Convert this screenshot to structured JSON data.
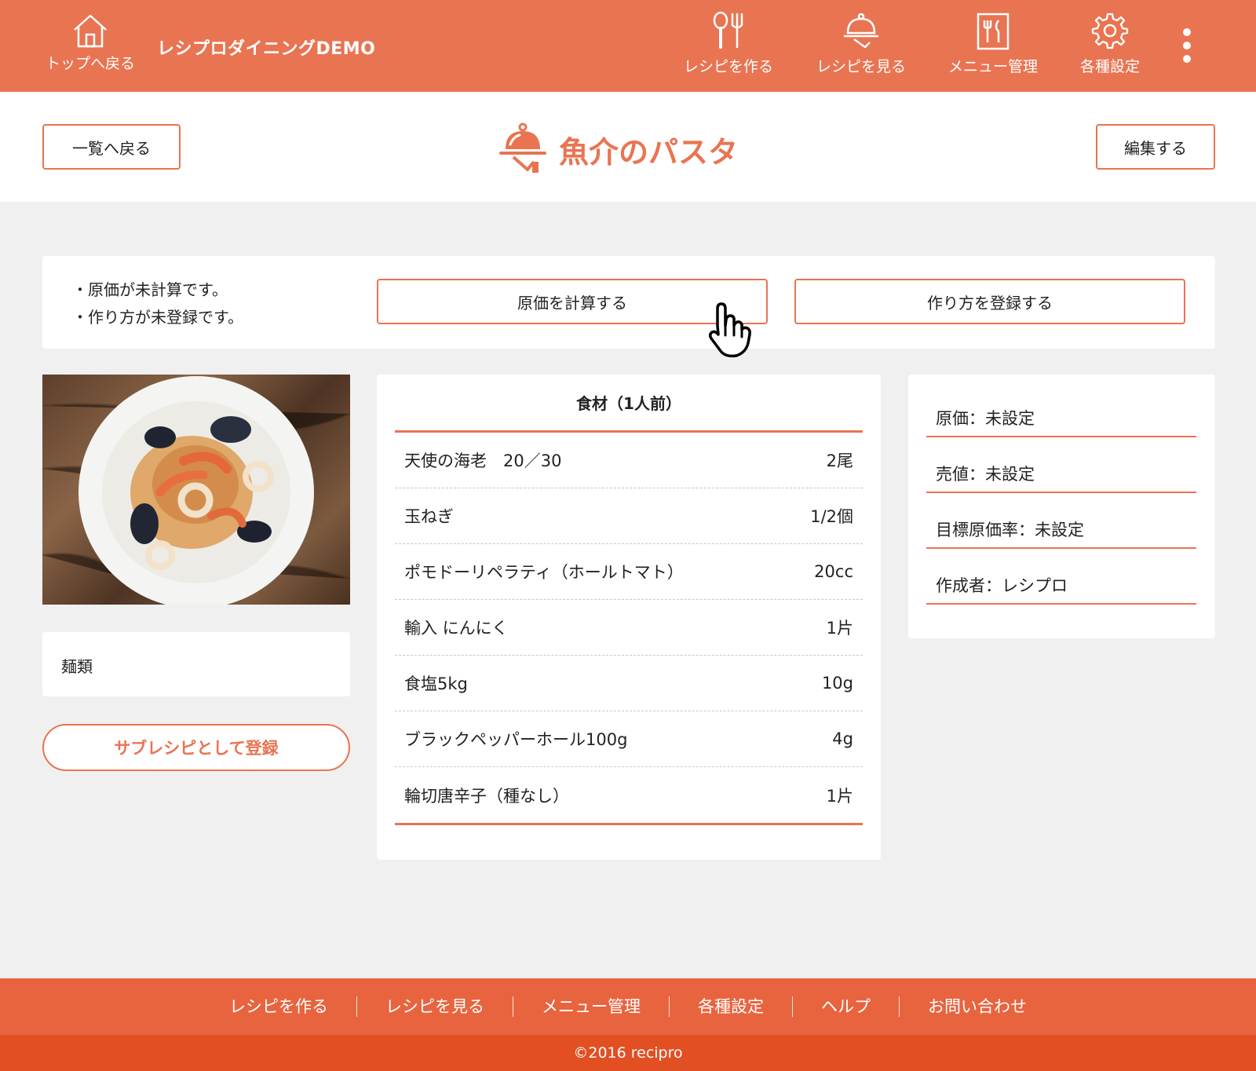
{
  "header": {
    "home_label": "トップへ戻る",
    "brand": "レシプロダイニングDEMO",
    "nav": [
      {
        "label": "レシピを作る",
        "icon": "utensils-icon"
      },
      {
        "label": "レシピを見る",
        "icon": "cloche-icon"
      },
      {
        "label": "メニュー管理",
        "icon": "menu-book-icon"
      },
      {
        "label": "各種設定",
        "icon": "gear-icon"
      }
    ]
  },
  "title_bar": {
    "back_label": "一覧へ戻る",
    "title": "魚介のパスタ",
    "edit_label": "編集する"
  },
  "notice": {
    "lines": [
      "・原価が未計算です。",
      "・作り方が未登録です。"
    ],
    "calc_label": "原価を計算する",
    "method_label": "作り方を登録する"
  },
  "category": "麺類",
  "sub_recipe_label": "サブレシピとして登録",
  "ingredients": {
    "heading": "食材（1人前）",
    "items": [
      {
        "name": "天使の海老　20／30",
        "qty": "2尾"
      },
      {
        "name": "玉ねぎ",
        "qty": "1/2個"
      },
      {
        "name": "ポモドーリペラティ（ホールトマト）",
        "qty": "20cc"
      },
      {
        "name": "輸入 にんにく",
        "qty": "1片"
      },
      {
        "name": "食塩5kg",
        "qty": "10g"
      },
      {
        "name": "ブラックペッパーホール100g",
        "qty": "4g"
      },
      {
        "name": "輪切唐辛子（種なし）",
        "qty": "1片"
      }
    ]
  },
  "info": {
    "cost": "原価：未設定",
    "price": "売値：未設定",
    "target_rate": "目標原価率：未設定",
    "author": "作成者：レシプロ"
  },
  "footer": {
    "links": [
      "レシピを作る",
      "レシピを見る",
      "メニュー管理",
      "各種設定",
      "ヘルプ",
      "お問い合わせ"
    ],
    "copyright": "©2016 recipro"
  },
  "colors": {
    "accent": "#e97452",
    "footer": "#e8643f",
    "footer_dark": "#e24f22",
    "background": "#f0f0f0"
  }
}
